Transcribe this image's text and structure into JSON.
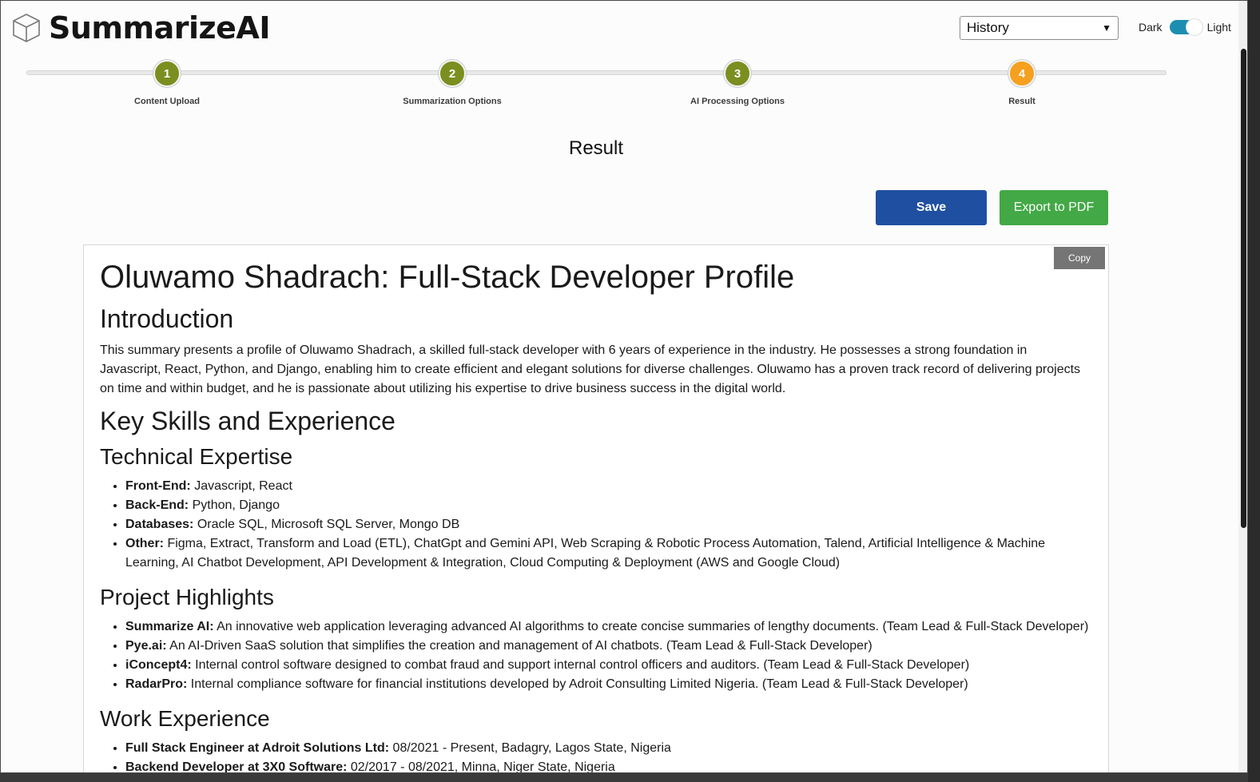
{
  "app": {
    "title": "SummarizeAI"
  },
  "header": {
    "history_select": "History",
    "theme_dark": "Dark",
    "theme_light": "Light"
  },
  "colors": {
    "step_done": "#7a8f1f",
    "step_active": "#f5a01e",
    "save": "#1f4fa0",
    "export": "#43a846"
  },
  "steps": [
    {
      "num": "1",
      "label": "Content Upload",
      "state": "done"
    },
    {
      "num": "2",
      "label": "Summarization Options",
      "state": "done"
    },
    {
      "num": "3",
      "label": "AI Processing Options",
      "state": "done"
    },
    {
      "num": "4",
      "label": "Result",
      "state": "active"
    }
  ],
  "page": {
    "heading": "Result"
  },
  "actions": {
    "save": "Save",
    "export": "Export to PDF",
    "copy": "Copy"
  },
  "document": {
    "title": "Oluwamo Shadrach: Full-Stack Developer Profile",
    "intro_heading": "Introduction",
    "intro_text": "This summary presents a profile of Oluwamo Shadrach, a skilled full-stack developer with 6 years of experience in the industry. He possesses a strong foundation in Javascript, React, Python, and Django, enabling him to create efficient and elegant solutions for diverse challenges. Oluwamo has a proven track record of delivering projects on time and within budget, and he is passionate about utilizing his expertise to drive business success in the digital world.",
    "skills_heading": "Key Skills and Experience",
    "tech_heading": "Technical Expertise",
    "tech_items": [
      {
        "label": "Front-End:",
        "text": " Javascript, React"
      },
      {
        "label": "Back-End:",
        "text": " Python, Django"
      },
      {
        "label": "Databases:",
        "text": " Oracle SQL, Microsoft SQL Server, Mongo DB"
      },
      {
        "label": "Other:",
        "text": " Figma, Extract, Transform and Load (ETL), ChatGpt and Gemini API, Web Scraping & Robotic Process Automation, Talend, Artificial Intelligence & Machine Learning, AI Chatbot Development, API Development & Integration, Cloud Computing & Deployment (AWS and Google Cloud)"
      }
    ],
    "projects_heading": "Project Highlights",
    "project_items": [
      {
        "label": "Summarize AI:",
        "text": " An innovative web application leveraging advanced AI algorithms to create concise summaries of lengthy documents. (Team Lead & Full-Stack Developer)"
      },
      {
        "label": "Pye.ai:",
        "text": " An AI-Driven SaaS solution that simplifies the creation and management of AI chatbots. (Team Lead & Full-Stack Developer)"
      },
      {
        "label": "iConcept4:",
        "text": " Internal control software designed to combat fraud and support internal control officers and auditors. (Team Lead & Full-Stack Developer)"
      },
      {
        "label": "RadarPro:",
        "text": " Internal compliance software for financial institutions developed by Adroit Consulting Limited Nigeria. (Team Lead & Full-Stack Developer)"
      }
    ],
    "work_heading": "Work Experience",
    "work_items": [
      {
        "label": "Full Stack Engineer at Adroit Solutions Ltd:",
        "text": " 08/2021 - Present, Badagry, Lagos State, Nigeria"
      },
      {
        "label": "Backend Developer at 3X0 Software:",
        "text": " 02/2017 - 08/2021, Minna, Niger State, Nigeria"
      }
    ]
  }
}
